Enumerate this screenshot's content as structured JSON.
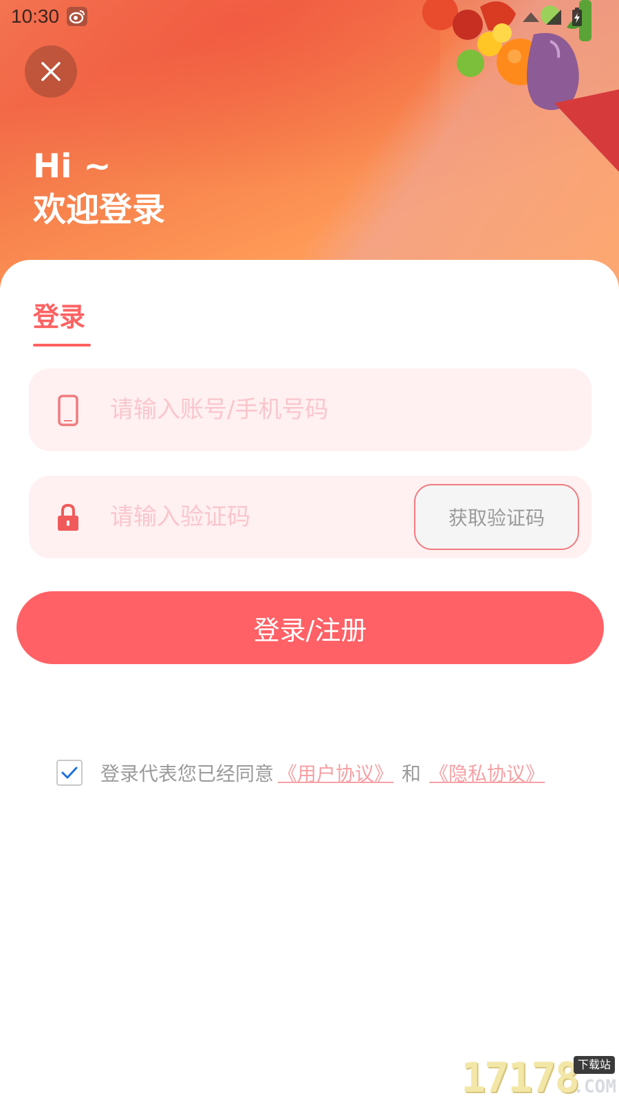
{
  "status_bar": {
    "time": "10:30",
    "app_icon": "weibo-icon",
    "right_icons": [
      "wifi-icon",
      "signal-icon",
      "battery-charging-icon"
    ]
  },
  "header": {
    "close_icon": "close-icon",
    "greeting_line1": "Hi ~",
    "greeting_line2": "欢迎登录"
  },
  "login": {
    "tab_label": "登录",
    "phone_icon": "phone-icon",
    "phone_placeholder": "请输入账号/手机号码",
    "phone_value": "",
    "lock_icon": "lock-icon",
    "code_placeholder": "请输入验证码",
    "code_value": "",
    "get_code_label": "获取验证码",
    "submit_label": "登录/注册"
  },
  "agreement": {
    "checked": true,
    "prefix": "登录代表您已经同意",
    "user_agreement": "《用户协议》",
    "and": "和",
    "privacy_policy": "《隐私协议》"
  },
  "watermark": {
    "digits": "17178",
    "tag": "下载站",
    "suffix": ".COM"
  },
  "colors": {
    "accent": "#fe6262",
    "field_bg": "#fff0f1",
    "placeholder": "#f9c6cc",
    "link": "#f7a0a4",
    "header_orange": "#ff9a58"
  }
}
